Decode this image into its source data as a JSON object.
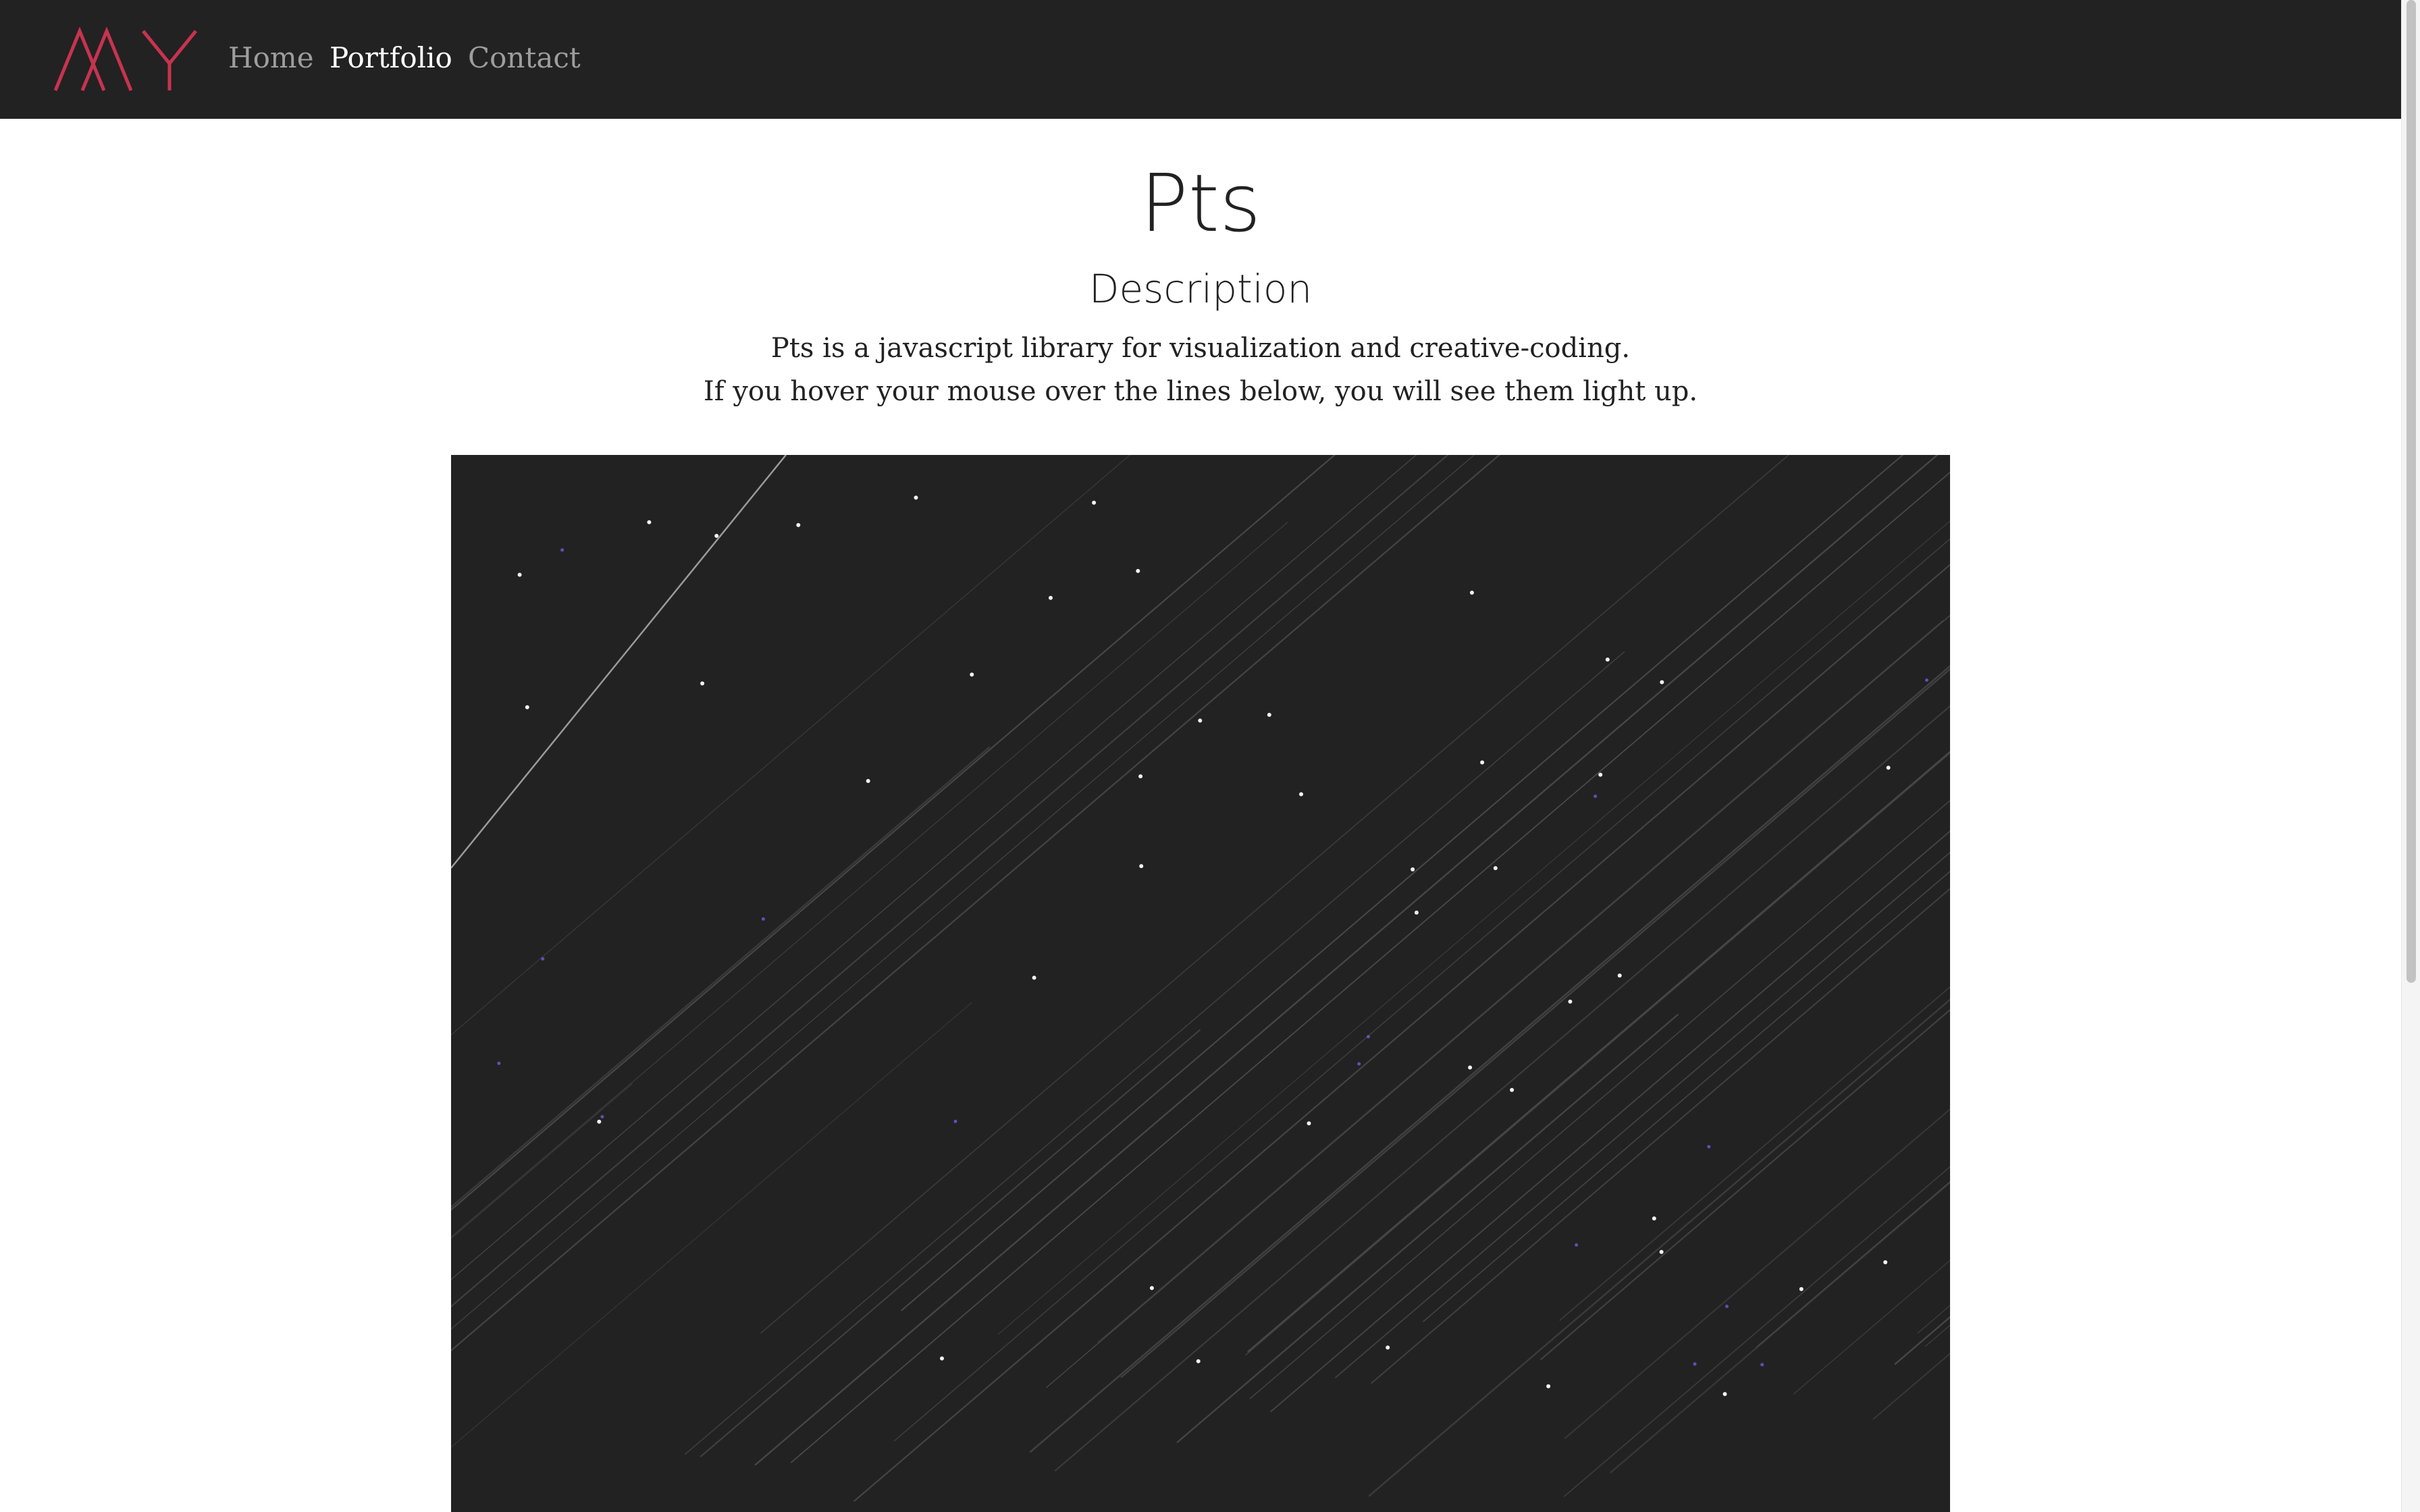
{
  "nav": {
    "logo_text": "MY",
    "links": [
      "Home",
      "Portfolio",
      "Contact"
    ],
    "active": "Portfolio"
  },
  "main": {
    "title": "Pts",
    "section_title": "Description",
    "description_lines": [
      "Pts is a javascript library for visualization and creative-coding.",
      "If you hover your mouse over the lines below, you will see them light up."
    ]
  },
  "canvas": {
    "background": "#222222",
    "line_color": "#4a4a4a",
    "highlight_line_color": "#9a9a9a",
    "dot_color": "#ffffff",
    "accent_dot_color": "#6b5ee0"
  },
  "colors": {
    "navbar_bg": "#222222",
    "logo_accent": "#c8334f",
    "nav_link": "#9d9d9d",
    "nav_link_active": "#ffffff",
    "text": "#222222"
  }
}
